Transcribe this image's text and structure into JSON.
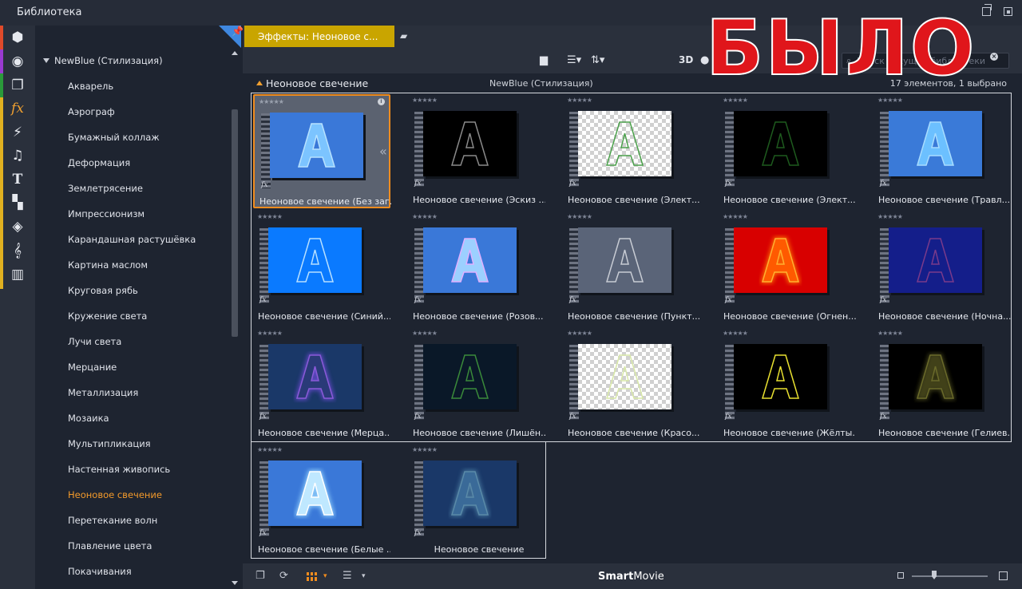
{
  "window": {
    "title": "Библиотека"
  },
  "tab": {
    "label": "Эффекты: Неоновое с..."
  },
  "toolbar": {
    "mode_3d": "3D",
    "search_placeholder": "Поиск текущей библиотеки"
  },
  "info": {
    "section_title": "Неоновое свечение",
    "category": "NewBlue (Стилизация)",
    "count": "17 элементов, 1 выбрано"
  },
  "tree": {
    "root": "NewBlue (Стилизация)",
    "items": [
      "Акварель",
      "Аэрограф",
      "Бумажный коллаж",
      "Деформация",
      "Землетрясение",
      "Импрессионизм",
      "Карандашная растушёвка",
      "Картина маслом",
      "Круговая рябь",
      "Кружение света",
      "Лучи света",
      "Мерцание",
      "Металлизация",
      "Мозаика",
      "Мультипликация",
      "Настенная живопись",
      "Неоновое свечение",
      "Перетекание волн",
      "Плавление цвета",
      "Покачивания"
    ],
    "selected_index": 16
  },
  "sidebar_icons": [
    "cube-icon",
    "film-reel-icon",
    "stack-icon",
    "fx-icon",
    "lightning-icon",
    "music-note-icon",
    "text-icon",
    "transition-icon",
    "layers-icon",
    "treble-clef-icon",
    "piano-icon"
  ],
  "sidebar_fx_glyph": "fx",
  "sidebar_text_glyph": "T",
  "sidebar_bar_colors": [
    "#e04a2a",
    "#9a3ad0",
    "#2a9a3a",
    "#e0b020"
  ],
  "tiles": [
    {
      "label": "Неоновое свечение (Без заг...",
      "bg": "#3a78d8",
      "fill": "#7cc4ff",
      "stroke": "#b8e2ff",
      "glow": "none",
      "checker": false,
      "selected": true
    },
    {
      "label": "Неоновое свечение (Эскиз ...",
      "bg": "#000000",
      "fill": "none",
      "stroke": "#8a8a8a",
      "glow": "none",
      "checker": false
    },
    {
      "label": "Неоновое свечение (Элект...",
      "bg": "#ffffff",
      "fill": "none",
      "stroke": "#4aa04a",
      "glow": "none",
      "checker": true
    },
    {
      "label": "Неоновое свечение (Элект...",
      "bg": "#000000",
      "fill": "none",
      "stroke": "#1e5a1e",
      "glow": "none",
      "checker": false
    },
    {
      "label": "Неоновое свечение (Травл...",
      "bg": "#3a7ad8",
      "fill": "#6cc0ff",
      "stroke": "#a8dcff",
      "glow": "none",
      "checker": false
    },
    {
      "label": "Неоновое свечение (Синий...",
      "bg": "#0a7aff",
      "fill": "none",
      "stroke": "#b8e0ff",
      "glow": "none",
      "checker": false
    },
    {
      "label": "Неоновое свечение (Розов...",
      "bg": "#3a78d8",
      "fill": "#9cd0ff",
      "stroke": "#e0b0ff",
      "glow": "none",
      "checker": false
    },
    {
      "label": "Неоновое свечение (Пункт...",
      "bg": "#5a6478",
      "fill": "none",
      "stroke": "#c8ccd4",
      "glow": "none",
      "checker": false
    },
    {
      "label": "Неоновое свечение (Огнен...",
      "bg": "#d80000",
      "fill": "#ff5a00",
      "stroke": "#ffb030",
      "glow": "#ff7a00",
      "checker": false
    },
    {
      "label": "Неоновое свечение (Ночна...",
      "bg": "#141e8a",
      "fill": "none",
      "stroke": "#7a3a8a",
      "glow": "none",
      "checker": false
    },
    {
      "label": "Неоновое свечение (Мерца...",
      "bg": "#1a3868",
      "fill": "#2a3a78",
      "stroke": "#8a5ad8",
      "glow": "#6a4ad0",
      "checker": false
    },
    {
      "label": "Неоновое свечение (Лишён...",
      "bg": "#0a1828",
      "fill": "none",
      "stroke": "#3a8a3a",
      "glow": "none",
      "checker": false
    },
    {
      "label": "Неоновое свечение (Красо...",
      "bg": "#ffffff",
      "fill": "none",
      "stroke": "#d8e8a8",
      "glow": "none",
      "checker": true
    },
    {
      "label": "Неоновое свечение (Жёлты...",
      "bg": "#000000",
      "fill": "none",
      "stroke": "#e8e030",
      "glow": "none",
      "checker": false
    },
    {
      "label": "Неоновое свечение (Гелиев...",
      "bg": "#000000",
      "fill": "none",
      "stroke": "#6a6a2a",
      "glow": "#4a4a1a",
      "checker": false
    },
    {
      "label": "Неоновое свечение (Белые ...",
      "bg": "#3a78d8",
      "fill": "#bfe8ff",
      "stroke": "#ffffff",
      "glow": "#9ad8ff",
      "checker": false
    },
    {
      "label": "Неоновое свечение",
      "bg": "#1a3868",
      "fill": "#3a6a98",
      "stroke": "#5a8aa8",
      "glow": "#4a7aa0",
      "checker": false,
      "center": true
    }
  ],
  "thumb_glyph": "A",
  "star_rating": "★★★★★",
  "fx_glyph": "fx",
  "bottombar": {
    "brand_bold": "Smart",
    "brand_rest": "Movie"
  },
  "overlay": {
    "text": "БЫЛО"
  }
}
